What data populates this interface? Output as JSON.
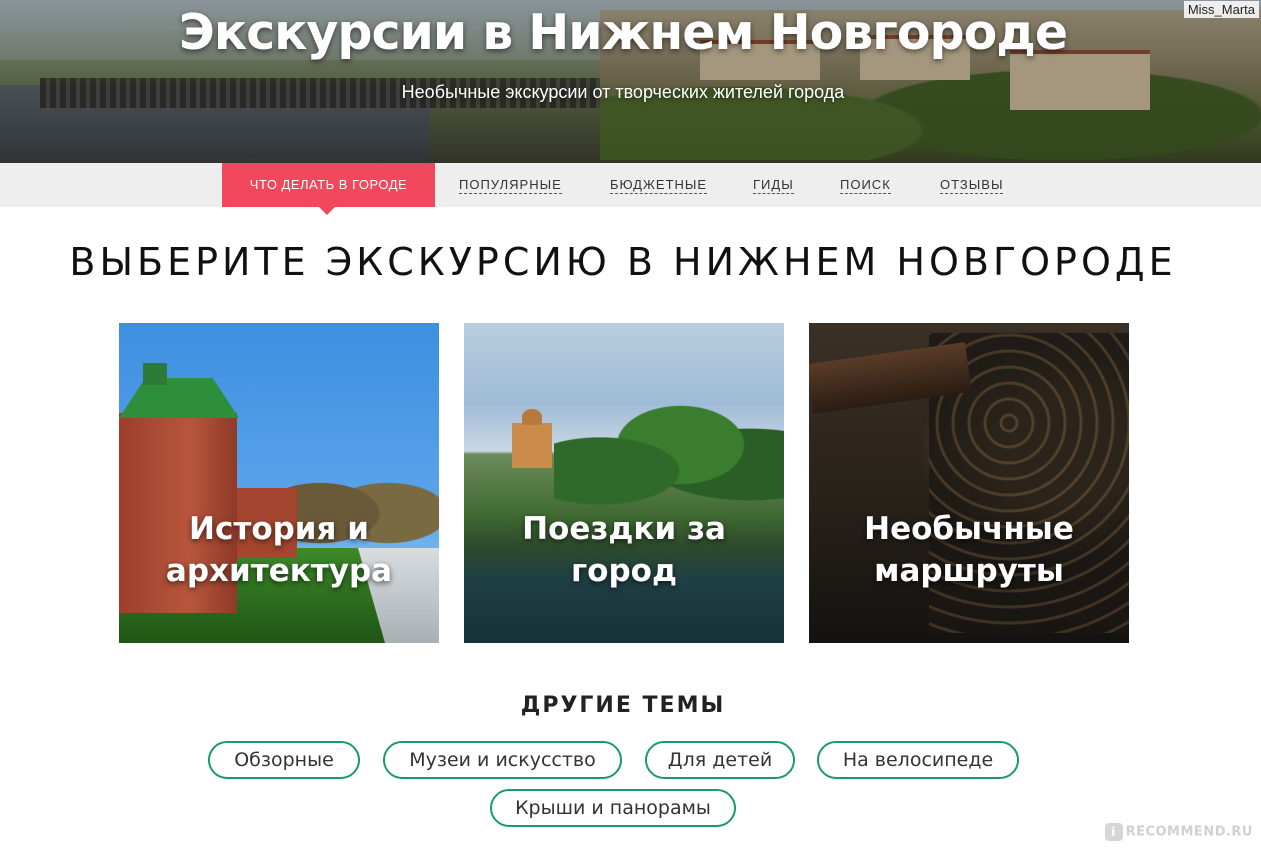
{
  "hero": {
    "title": "Экскурсии в Нижнем Новгороде",
    "subtitle": "Необычные экскурсии от творческих жителей города",
    "watermark": "Miss_Marta"
  },
  "nav": {
    "active": "ЧТО ДЕЛАТЬ В ГОРОДЕ",
    "items": [
      "ПОПУЛЯРНЫЕ",
      "БЮДЖЕТНЫЕ",
      "ГИДЫ",
      "ПОИСК",
      "ОТЗЫВЫ"
    ],
    "accent_color": "#f2485e"
  },
  "main": {
    "heading": "ВЫБЕРИТЕ ЭКСКУРСИЮ В НИЖНЕМ НОВГОРОДЕ",
    "cards": [
      {
        "line1": "История и",
        "line2": "архитектура"
      },
      {
        "line1": "Поездки за",
        "line2": "город"
      },
      {
        "line1": "Необычные",
        "line2": "маршруты"
      }
    ]
  },
  "other": {
    "title": "ДРУГИЕ ТЕМЫ",
    "tags": [
      "Обзорные",
      "Музеи и искусство",
      "Для детей",
      "На велосипеде",
      "Крыши и панорамы"
    ],
    "tag_color": "#1a9a72"
  },
  "footer": {
    "watermark": "RECOMMEND.RU"
  }
}
